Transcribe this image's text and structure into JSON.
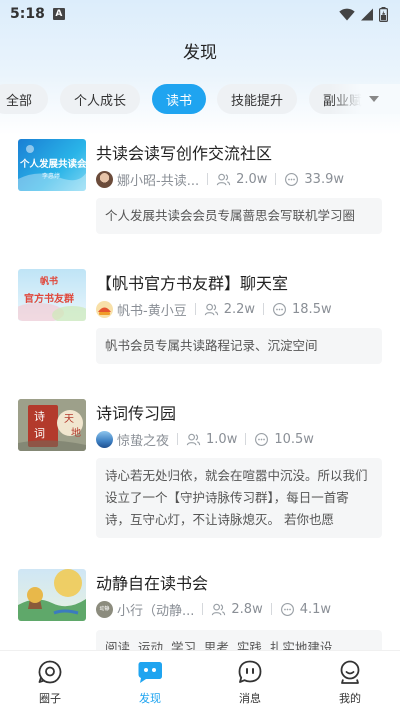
{
  "status_bar": {
    "time": "5:18",
    "badge": "A"
  },
  "header": {
    "title": "发现"
  },
  "tabs": [
    {
      "label": "全部",
      "active": false
    },
    {
      "label": "个人成长",
      "active": false
    },
    {
      "label": "读书",
      "active": true
    },
    {
      "label": "技能提升",
      "active": false
    },
    {
      "label": "副业赋",
      "active": false
    }
  ],
  "items": [
    {
      "title": "共读会读写创作交流社区",
      "owner": "娜小昭-共读...",
      "members": "2.0w",
      "messages": "33.9w",
      "description": "个人发展共读会会员专属蔷思会写联机学习圈",
      "thumb_text": "个人发展共读会",
      "thumb_sub": "李惠婷"
    },
    {
      "title": "【帆书官方书友群】聊天室",
      "owner": "帆书-黄小豆",
      "members": "2.2w",
      "messages": "18.5w",
      "description": "帆书会员专属共读路程记录、沉淀空间",
      "thumb_text_1": "帆书",
      "thumb_text_2": "官方书友群"
    },
    {
      "title": "诗词传习园",
      "owner": "惊蛰之夜",
      "members": "1.0w",
      "messages": "10.5w",
      "description": "诗心若无处归依，就会在喧嚣中沉没。所以我们设立了一个【守护诗脉传习群】，每日一首寄诗，互守心灯，不让诗脉熄灭。 若你也愿",
      "thumb_chars": [
        "诗",
        "词",
        "天",
        "地"
      ]
    },
    {
      "title": "动静自在读书会",
      "owner": "小行（动静...",
      "members": "2.8w",
      "messages": "4.1w",
      "description": "阅读  运动  学习  思考  实践  扎实地建设",
      "avatar_text": "动静"
    }
  ],
  "bottom_nav": [
    {
      "label": "圈子",
      "icon": "circle-chat-icon",
      "active": false
    },
    {
      "label": "发现",
      "icon": "discover-icon",
      "active": true
    },
    {
      "label": "消息",
      "icon": "message-icon",
      "active": false
    },
    {
      "label": "我的",
      "icon": "profile-icon",
      "active": false
    }
  ],
  "colors": {
    "accent": "#1fa4f0",
    "tab_bg": "#eef1f4",
    "desc_bg": "#f5f6f7",
    "meta_text": "#8a8f96"
  }
}
